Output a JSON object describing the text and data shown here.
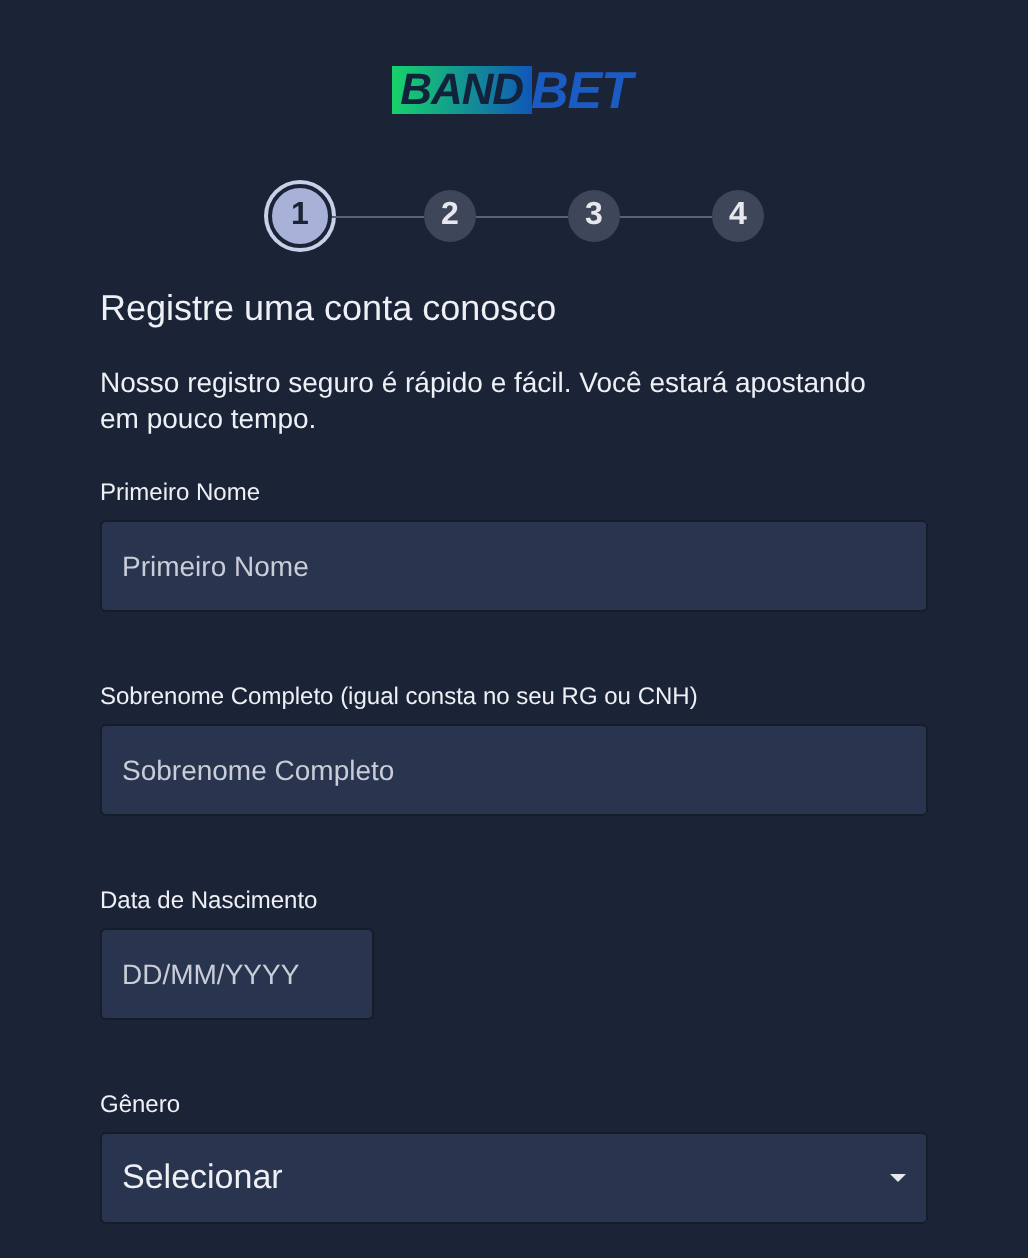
{
  "logo": {
    "part_1": "BAND",
    "part_2": "BET"
  },
  "steps": [
    {
      "label": "1",
      "selected": true
    },
    {
      "label": "2",
      "selected": false
    },
    {
      "label": "3",
      "selected": false
    },
    {
      "label": "4",
      "selected": false
    }
  ],
  "heading": "Registre uma conta conosco",
  "intro": "Nosso registro seguro é rápido e fácil. Você estará apostando em pouco tempo.",
  "fields": [
    {
      "kind": "text",
      "label": "Primeiro Nome",
      "placeholder": "Primeiro Nome"
    },
    {
      "kind": "text",
      "label": "Sobrenome Completo (igual consta no seu RG ou CNH)",
      "placeholder": "Sobrenome Completo"
    },
    {
      "kind": "date",
      "label": "Data de Nascimento",
      "placeholder": "DD/MM/YYYY"
    },
    {
      "kind": "select",
      "label": "Gênero",
      "value": "Selecionar"
    }
  ]
}
